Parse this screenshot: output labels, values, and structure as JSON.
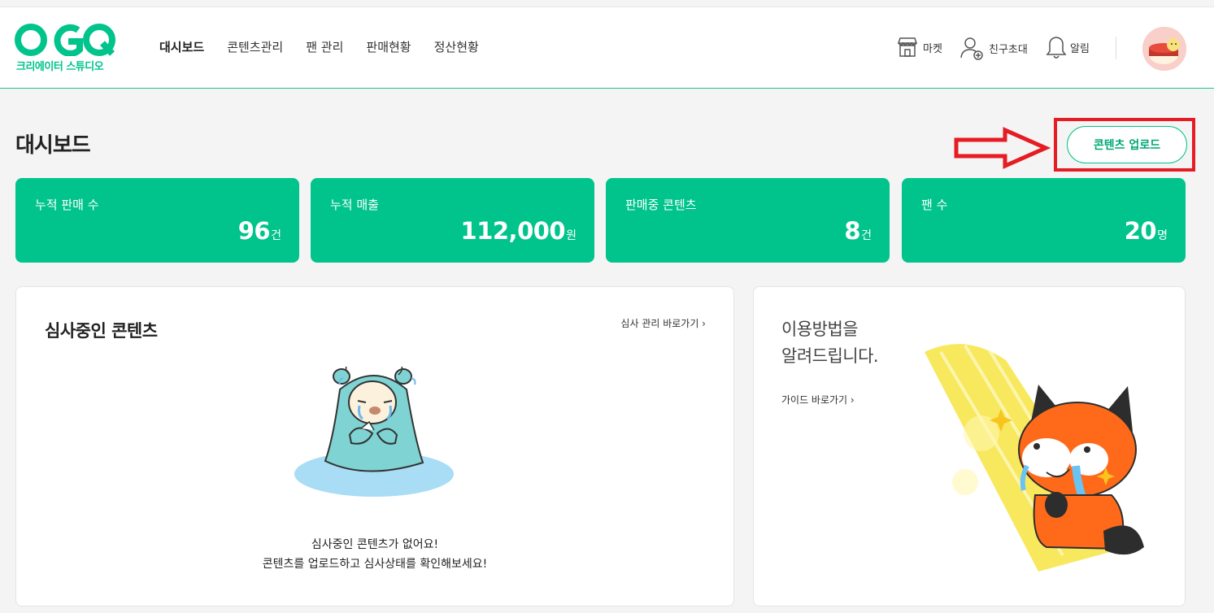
{
  "header": {
    "logo_text": "OGQ",
    "logo_subtitle": "크리에이터 스튜디오",
    "nav": [
      {
        "label": "대시보드",
        "active": true
      },
      {
        "label": "콘텐츠관리"
      },
      {
        "label": "팬 관리"
      },
      {
        "label": "판매현황"
      },
      {
        "label": "정산현황"
      }
    ],
    "utils": {
      "market": {
        "label": "마켓",
        "icon": "store-icon"
      },
      "invite": {
        "label": "친구초대",
        "icon": "user-add-icon"
      },
      "alarm": {
        "label": "알림",
        "icon": "bell-icon"
      }
    }
  },
  "page": {
    "title": "대시보드",
    "upload_button": "콘텐츠 업로드"
  },
  "stats": [
    {
      "label": "누적 판매 수",
      "value": "96",
      "unit": "건"
    },
    {
      "label": "누적 매출",
      "value": "112,000",
      "unit": "원"
    },
    {
      "label": "판매중 콘텐츠",
      "value": "8",
      "unit": "건"
    },
    {
      "label": "팬 수",
      "value": "20",
      "unit": "명"
    }
  ],
  "review_panel": {
    "title": "심사중인 콘텐츠",
    "link": "심사 관리 바로가기 ›",
    "empty_line1": "심사중인 콘텐츠가 없어요!",
    "empty_line2": "콘텐츠를 업로드하고 심사상태를 확인해보세요!"
  },
  "guide_panel": {
    "title_line1": "이용방법을",
    "title_line2": "알려드립니다.",
    "link": "가이드 바로가기 ›"
  },
  "colors": {
    "brand": "#00c48c",
    "highlight": "#e51c23"
  }
}
